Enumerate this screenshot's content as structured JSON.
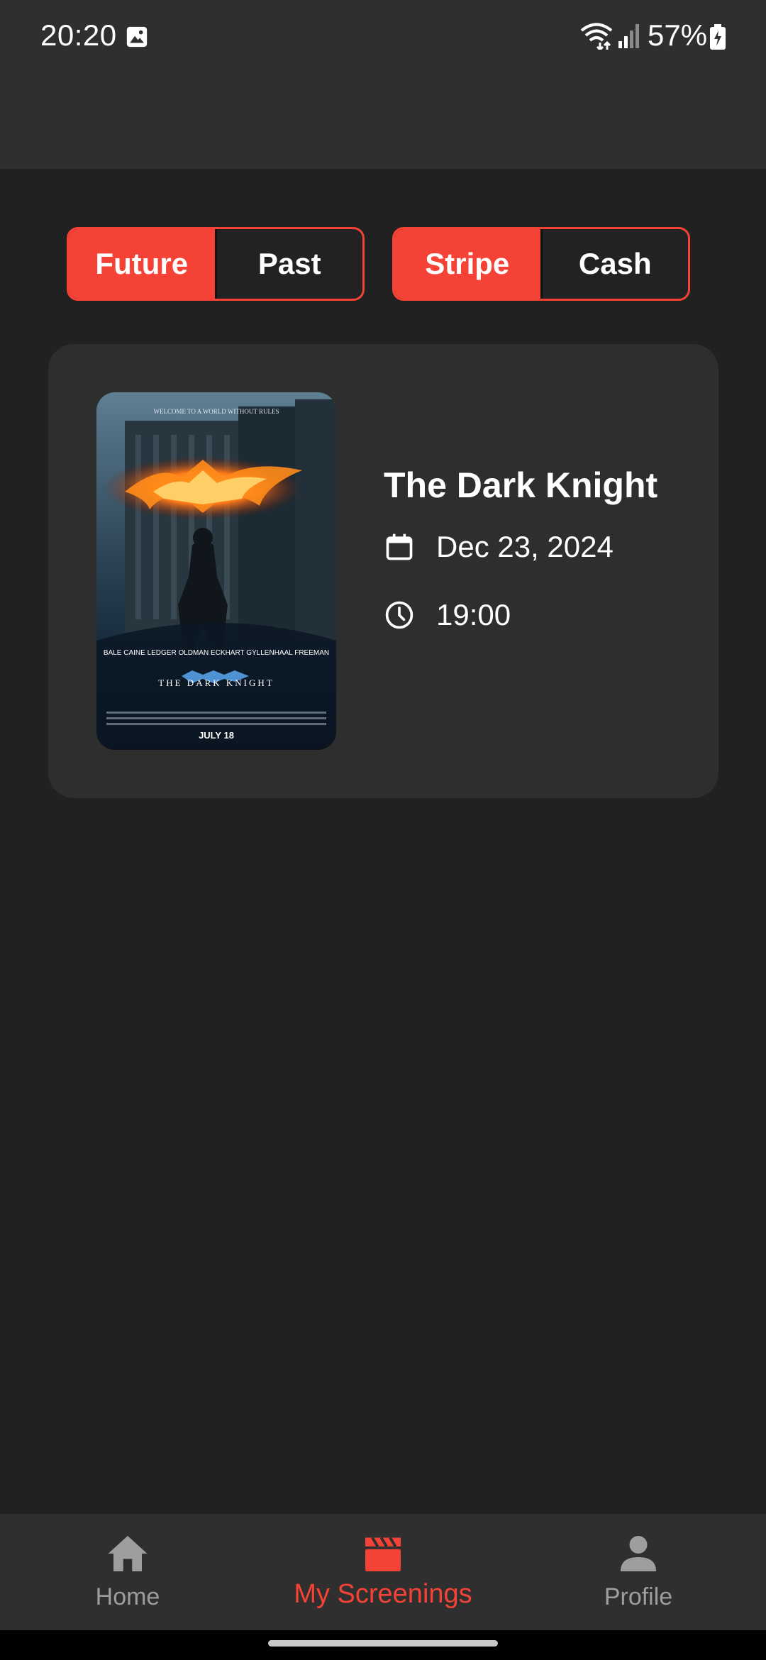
{
  "status_bar": {
    "time": "20:20",
    "battery": "57%",
    "icons": [
      "gallery-icon",
      "wifi-icon",
      "signal-icon",
      "battery-icon"
    ]
  },
  "filters": {
    "time_toggle": {
      "options": [
        "Future",
        "Past"
      ],
      "selected": "Future"
    },
    "payment_toggle": {
      "options": [
        "Stripe",
        "Cash"
      ],
      "selected": "Stripe"
    }
  },
  "screening": {
    "title": "The Dark Knight",
    "date": "Dec 23, 2024",
    "time": "19:00",
    "poster": {
      "tagline": "WELCOME TO A WORLD WITHOUT RULES",
      "cast": "BALE CAINE LEDGER OLDMAN ECKHART GYLLENHAAL FREEMAN",
      "logo_text": "THE DARK KNIGHT",
      "release": "JULY 18"
    }
  },
  "bottom_nav": {
    "items": [
      {
        "label": "Home",
        "icon": "home-icon",
        "active": false
      },
      {
        "label": "My Screenings",
        "icon": "clapperboard-icon",
        "active": true
      },
      {
        "label": "Profile",
        "icon": "person-icon",
        "active": false
      }
    ]
  },
  "colors": {
    "accent": "#f44336",
    "background": "#212121",
    "surface": "#2e2e2e",
    "bar": "#2f2f2f",
    "inactive": "#9e9e9e"
  }
}
